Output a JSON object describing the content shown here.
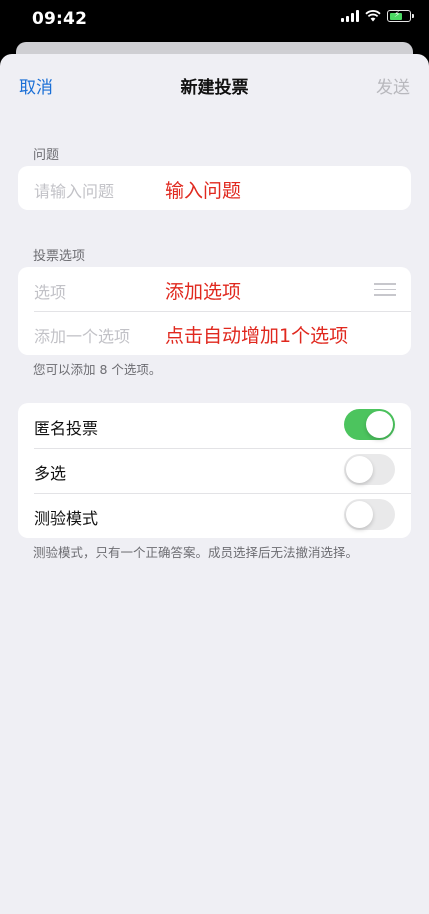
{
  "status": {
    "time": "09:42"
  },
  "nav": {
    "cancel": "取消",
    "title": "新建投票",
    "send": "发送"
  },
  "question": {
    "header": "问题",
    "placeholder": "请输入问题",
    "annotation": "输入问题"
  },
  "options": {
    "header": "投票选项",
    "items": [
      {
        "placeholder": "选项",
        "annotation": "添加选项"
      },
      {
        "placeholder": "添加一个选项",
        "annotation": "点击自动增加1个选项"
      }
    ],
    "footer": "您可以添加 8 个选项。"
  },
  "settings": {
    "items": [
      {
        "label": "匿名投票",
        "on": true
      },
      {
        "label": "多选",
        "on": false
      },
      {
        "label": "测验模式",
        "on": false
      }
    ],
    "footer": "测验模式，只有一个正确答案。成员选择后无法撤消选择。"
  },
  "colors": {
    "accent": "#1a6fd6",
    "toggle_on": "#4cc45e",
    "annotation": "#e0281e",
    "battery": "#4cd964"
  },
  "icons": [
    "signal-icon",
    "wifi-icon",
    "battery-charging-icon",
    "drag-handle-icon"
  ]
}
